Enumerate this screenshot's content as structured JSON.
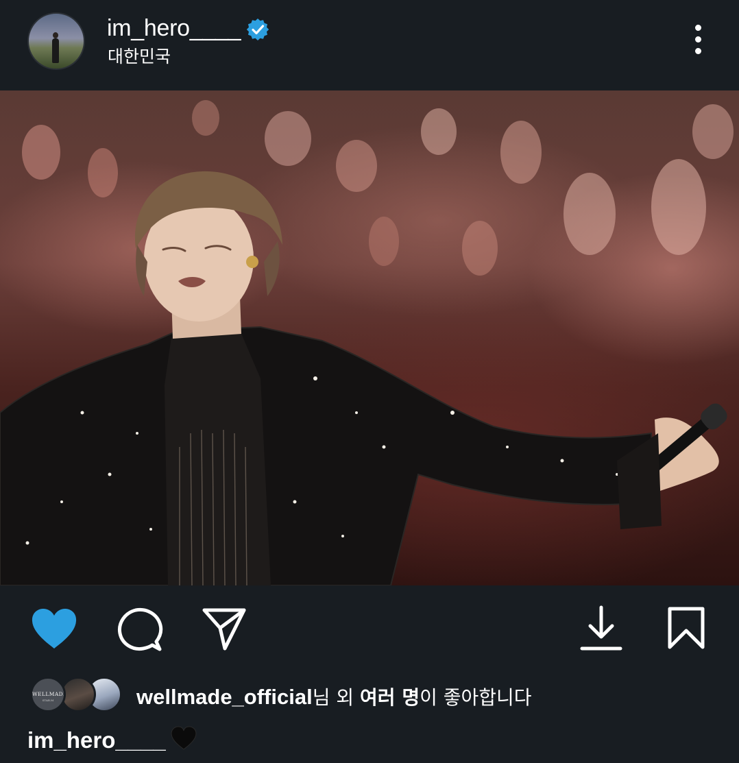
{
  "post": {
    "username": "im_hero____",
    "location": "대한민국",
    "verified": true,
    "verified_color": "#2c9fe0"
  },
  "icons": {
    "more": "more-vertical-icon",
    "like": "heart-icon",
    "comment": "comment-bubble-icon",
    "share": "send-paper-plane-icon",
    "download": "download-icon",
    "save": "bookmark-icon"
  },
  "likes": {
    "liker_avatar_1_text": "WELLMADE",
    "liker_avatar_1_subtext": "STAR.M",
    "first_liker": "wellmade_official",
    "suffix_1": "님 외 ",
    "others": "여러 명",
    "suffix_2": "이 좋아합니다"
  },
  "caption": {
    "username": "im_hero____",
    "emoji": "black-heart"
  },
  "colors": {
    "background": "#181d22",
    "like_active": "#2c9fe0",
    "text": "#ffffff"
  }
}
